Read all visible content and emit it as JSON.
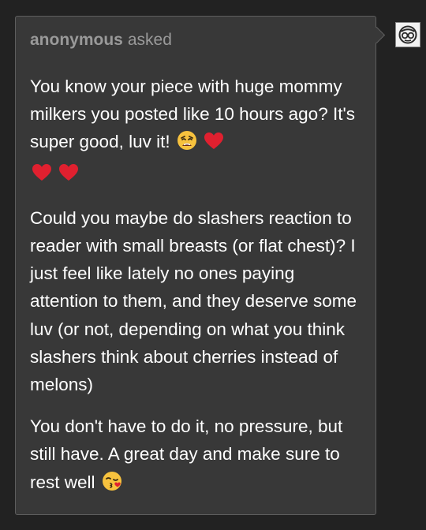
{
  "ask": {
    "asker_name": "anonymous",
    "asker_verb": "asked",
    "paragraph_1": {
      "text": "You know your piece with huge mommy milkers you posted like 10 hours ago? It's super good, luv it!",
      "emojis": [
        "weary-face-emoji",
        "red-heart-emoji",
        "red-heart-emoji",
        "red-heart-emoji"
      ]
    },
    "paragraph_2": {
      "text": "Could you maybe do slashers reaction to reader with small breasts (or flat chest)? I just feel like lately no ones paying attention to them, and they deserve some luv (or not, depending on what you think slashers think about cherries instead of melons)"
    },
    "paragraph_3": {
      "text": "You don't have to do it, no pressure, but still have. A great day and make sure to rest well",
      "emojis": [
        "face-blowing-kiss-emoji"
      ]
    }
  },
  "avatar": {
    "icon": "glasses-avatar-icon"
  },
  "colors": {
    "background": "#222222",
    "card": "#383838",
    "card_border": "#5e5e5e",
    "asker_text": "#9a9a9a",
    "body_text": "#ffffff",
    "heart": "#e0202f",
    "emoji_face": "#f7c23e"
  }
}
